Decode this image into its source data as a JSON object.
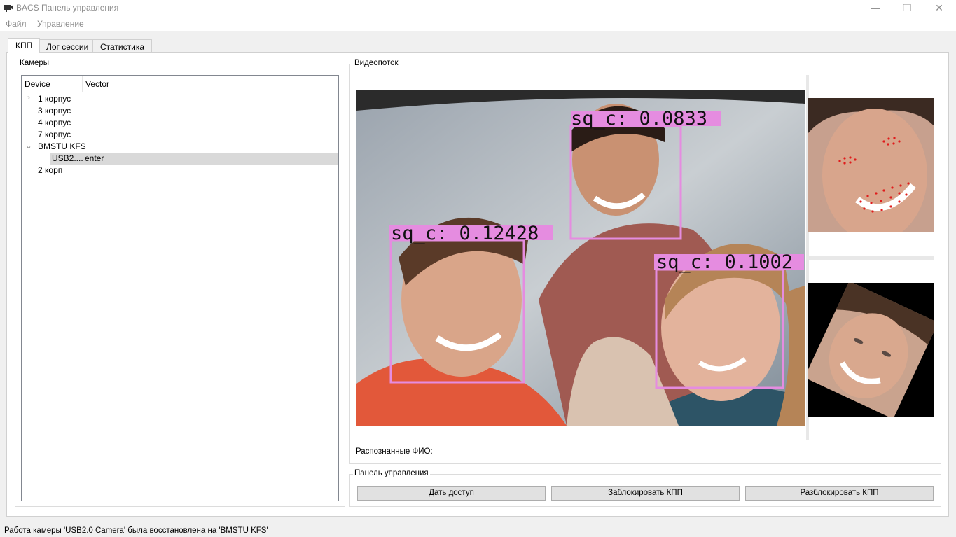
{
  "window": {
    "title": "BACS Панель управления",
    "minimize_glyph": "—",
    "restore_glyph": "❐",
    "close_glyph": "✕"
  },
  "menu": [
    "Файл",
    "Управление"
  ],
  "tabs": [
    {
      "label": "КПП",
      "active": true
    },
    {
      "label": "Лог сессии",
      "active": false
    },
    {
      "label": "Статистика",
      "active": false
    }
  ],
  "cameras": {
    "title": "Камеры",
    "columns": [
      "Device",
      "Vector"
    ],
    "rows": [
      {
        "label": "1 корпус",
        "vector": "",
        "expander": "collapsed",
        "level": 0,
        "selected": false
      },
      {
        "label": "3 корпус",
        "vector": "",
        "expander": "none",
        "level": 0,
        "selected": false
      },
      {
        "label": "4 корпус",
        "vector": "",
        "expander": "none",
        "level": 0,
        "selected": false
      },
      {
        "label": "7 корпус",
        "vector": "",
        "expander": "none",
        "level": 0,
        "selected": false
      },
      {
        "label": "BMSTU KFS",
        "vector": "",
        "expander": "expanded",
        "level": 0,
        "selected": false
      },
      {
        "label": "USB2....",
        "vector": "enter",
        "expander": "none",
        "level": 1,
        "selected": true
      },
      {
        "label": "2 корп",
        "vector": "",
        "expander": "none",
        "level": 0,
        "selected": false
      }
    ]
  },
  "video": {
    "title": "Видеопоток",
    "detections": [
      {
        "label": "sq_c: 0.0833"
      },
      {
        "label": "sq_c: 0.12428"
      },
      {
        "label": "sq_c: 0.1002"
      }
    ],
    "box_color": "#e58ce0",
    "recognized_label": "Распознанные ФИО:"
  },
  "control_panel": {
    "title": "Панель управления",
    "buttons": [
      "Дать доступ",
      "Заблокировать КПП",
      "Разблокировать КПП"
    ]
  },
  "status": "Работа камеры 'USB2.0 Camera' была восстановлена на 'BMSTU KFS'"
}
